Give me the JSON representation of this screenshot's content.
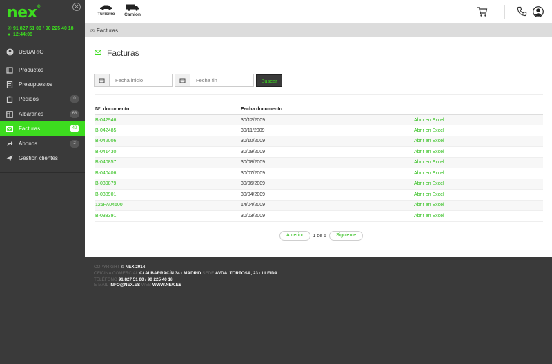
{
  "brand": {
    "logo": "nex",
    "logo_mark": "®",
    "accent": "#3ddc1f"
  },
  "sidebar": {
    "phone": "91 827 51 00 / 90 225 40 18",
    "time": "12:44:08",
    "user_label": "USUARIO",
    "items": [
      {
        "label": "Productos",
        "badge": ""
      },
      {
        "label": "Presupuestos",
        "badge": ""
      },
      {
        "label": "Pedidos",
        "badge": "0"
      },
      {
        "label": "Albaranes",
        "badge": "68"
      },
      {
        "label": "Facturas",
        "badge": "42",
        "active": true
      },
      {
        "label": "Abonos",
        "badge": "2"
      },
      {
        "label": "Gestión clientes",
        "badge": ""
      }
    ]
  },
  "header": {
    "vehicles": [
      {
        "label": "Turismo"
      },
      {
        "label": "Camión"
      }
    ],
    "icons": [
      "cart-icon",
      "phone-icon",
      "user-icon"
    ]
  },
  "breadcrumb": {
    "label": "Facturas"
  },
  "main": {
    "title": "Facturas",
    "filters": {
      "start_placeholder": "Fecha inicio",
      "end_placeholder": "Fecha fin",
      "search_label": "Buscar"
    },
    "table": {
      "headers": [
        "Nº. documento",
        "Fecha documento",
        ""
      ],
      "rows": [
        {
          "doc": "B-042946",
          "date": "30/12/2009",
          "action": "Abrir en Excel"
        },
        {
          "doc": "B-042485",
          "date": "30/11/2009",
          "action": "Abrir en Excel"
        },
        {
          "doc": "B-042006",
          "date": "30/10/2009",
          "action": "Abrir en Excel"
        },
        {
          "doc": "B-041430",
          "date": "30/09/2009",
          "action": "Abrir en Excel"
        },
        {
          "doc": "B-040857",
          "date": "30/08/2009",
          "action": "Abrir en Excel"
        },
        {
          "doc": "B-040406",
          "date": "30/07/2009",
          "action": "Abrir en Excel"
        },
        {
          "doc": "B-039879",
          "date": "30/06/2009",
          "action": "Abrir en Excel"
        },
        {
          "doc": "B-038901",
          "date": "30/04/2009",
          "action": "Abrir en Excel"
        },
        {
          "doc": "126FA04600",
          "date": "14/04/2009",
          "action": "Abrir en Excel"
        },
        {
          "doc": "B-038391",
          "date": "30/03/2009",
          "action": "Abrir en Excel"
        }
      ]
    },
    "pagination": {
      "prev": "Anterior",
      "info": "1 de 5",
      "next": "Siguiente"
    }
  },
  "footer": {
    "copyright_key": "COPYRIGHT",
    "copyright_val": "© NEX 2014",
    "office_key": "OFICINA COMERCIAL",
    "office_val": "C/ ALBARRACÍN 34 · MADRID",
    "sede_key": "SEDE",
    "sede_val": "AVDA. TORTOSA, 23 · LLEIDA",
    "tel_key": "TELÉFONO",
    "tel_val": "91 827 51 00 / 90 225 40 18",
    "email_key": "E-MAIL",
    "email_val": "INFO@NEX.ES",
    "web_key": "WEB",
    "web_val": "WWW.NEX.ES"
  }
}
